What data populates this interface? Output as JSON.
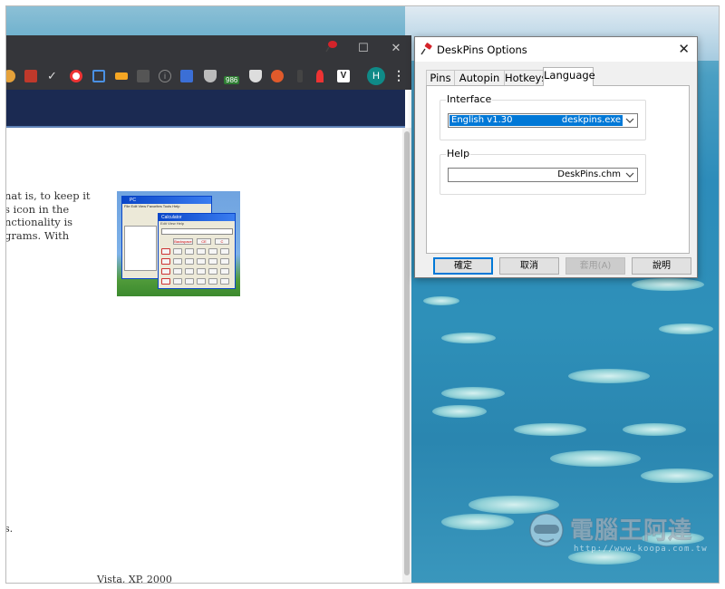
{
  "browser": {
    "window_controls": {
      "minimize": "—",
      "maximize": "☐",
      "close": "✕"
    },
    "avatar_letter": "H",
    "extension_badge": "986",
    "article_lines": [
      "nat is, to keep it",
      "s icon in the",
      "nctionality is",
      "grams. With"
    ],
    "bottom_fragment_1": "s.",
    "bottom_fragment_2": "Vista, XP, 2000"
  },
  "thumbnail": {
    "explorer_title": "PC",
    "explorer_menu": "File  Edit  View  Favorites  Tools  Help",
    "calc_title": "Calculator",
    "calc_menu": "Edit  View  Help",
    "calc_buttons": [
      "Backspace",
      "CE",
      "C"
    ]
  },
  "dialog": {
    "title": "DeskPins Options",
    "close": "✕",
    "tabs": [
      {
        "label": "Pins"
      },
      {
        "label": "Autopin"
      },
      {
        "label": "Hotkeys"
      },
      {
        "label": "Language",
        "active": true
      }
    ],
    "interface": {
      "label": "Interface",
      "value_left": "English v1.30",
      "value_right": "deskpins.exe"
    },
    "help": {
      "label": "Help",
      "value": "DeskPins.chm"
    },
    "buttons": {
      "ok": "確定",
      "cancel": "取消",
      "apply": "套用(A)",
      "help": "說明"
    }
  },
  "watermark": {
    "text": "電腦王阿達",
    "url": "http://www.koopa.com.tw"
  },
  "colors": {
    "browser_chrome": "#35363a",
    "site_header": "#1b2a52",
    "selection_blue": "#0078d7",
    "avatar": "#0f8a87"
  }
}
